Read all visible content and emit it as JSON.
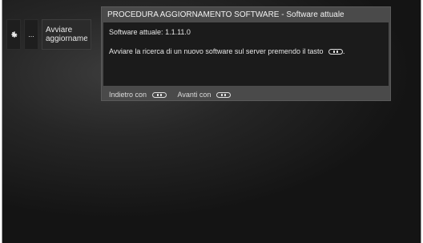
{
  "breadcrumb": {
    "gear_icon": "gear-icon",
    "ellipsis": "...",
    "current_line1": "Avviare",
    "current_line2": "aggiornamento"
  },
  "dialog": {
    "title": "PROCEDURA AGGIORNAMENTO SOFTWARE - Software attuale",
    "current_software_label": "Software attuale:",
    "current_software_value": "1.1.11.0",
    "instruction": "Avviare la ricerca di un nuovo software sul server premendo il tasto",
    "instruction_suffix": ".",
    "footer_back": "Indietro con",
    "footer_next": "Avanti con"
  },
  "colors": {
    "panel_bg": "#4a4a4a",
    "body_bg": "#1b1b1b",
    "text": "#e6e6e6"
  }
}
